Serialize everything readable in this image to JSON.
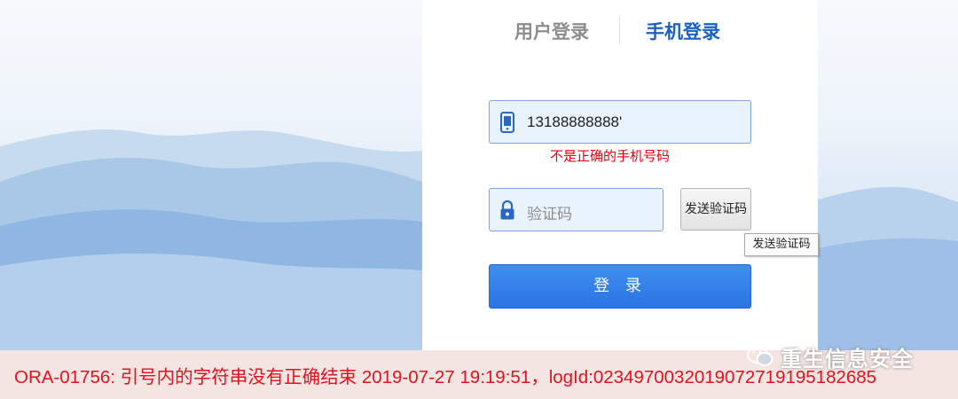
{
  "tabs": {
    "user_login": "用户登录",
    "phone_login": "手机登录"
  },
  "phone": {
    "value": "13188888888'"
  },
  "error_message": "不是正确的手机号码",
  "code": {
    "placeholder": "验证码"
  },
  "send_code_button": "发送验证码",
  "tooltip": "发送验证码",
  "login_button": "登 录",
  "db_error": "ORA-01756: 引号内的字符串没有正确结束 2019-07-27 19:19:51，logId:023497003201907271919518268​5",
  "watermark": "重生信息安全",
  "icons": {
    "phone": "mobile-phone-icon",
    "lock": "lock-icon",
    "wechat": "wechat-icon"
  },
  "colors": {
    "accent": "#1b61c5",
    "error": "#e60012",
    "button": "#2a74e3"
  }
}
